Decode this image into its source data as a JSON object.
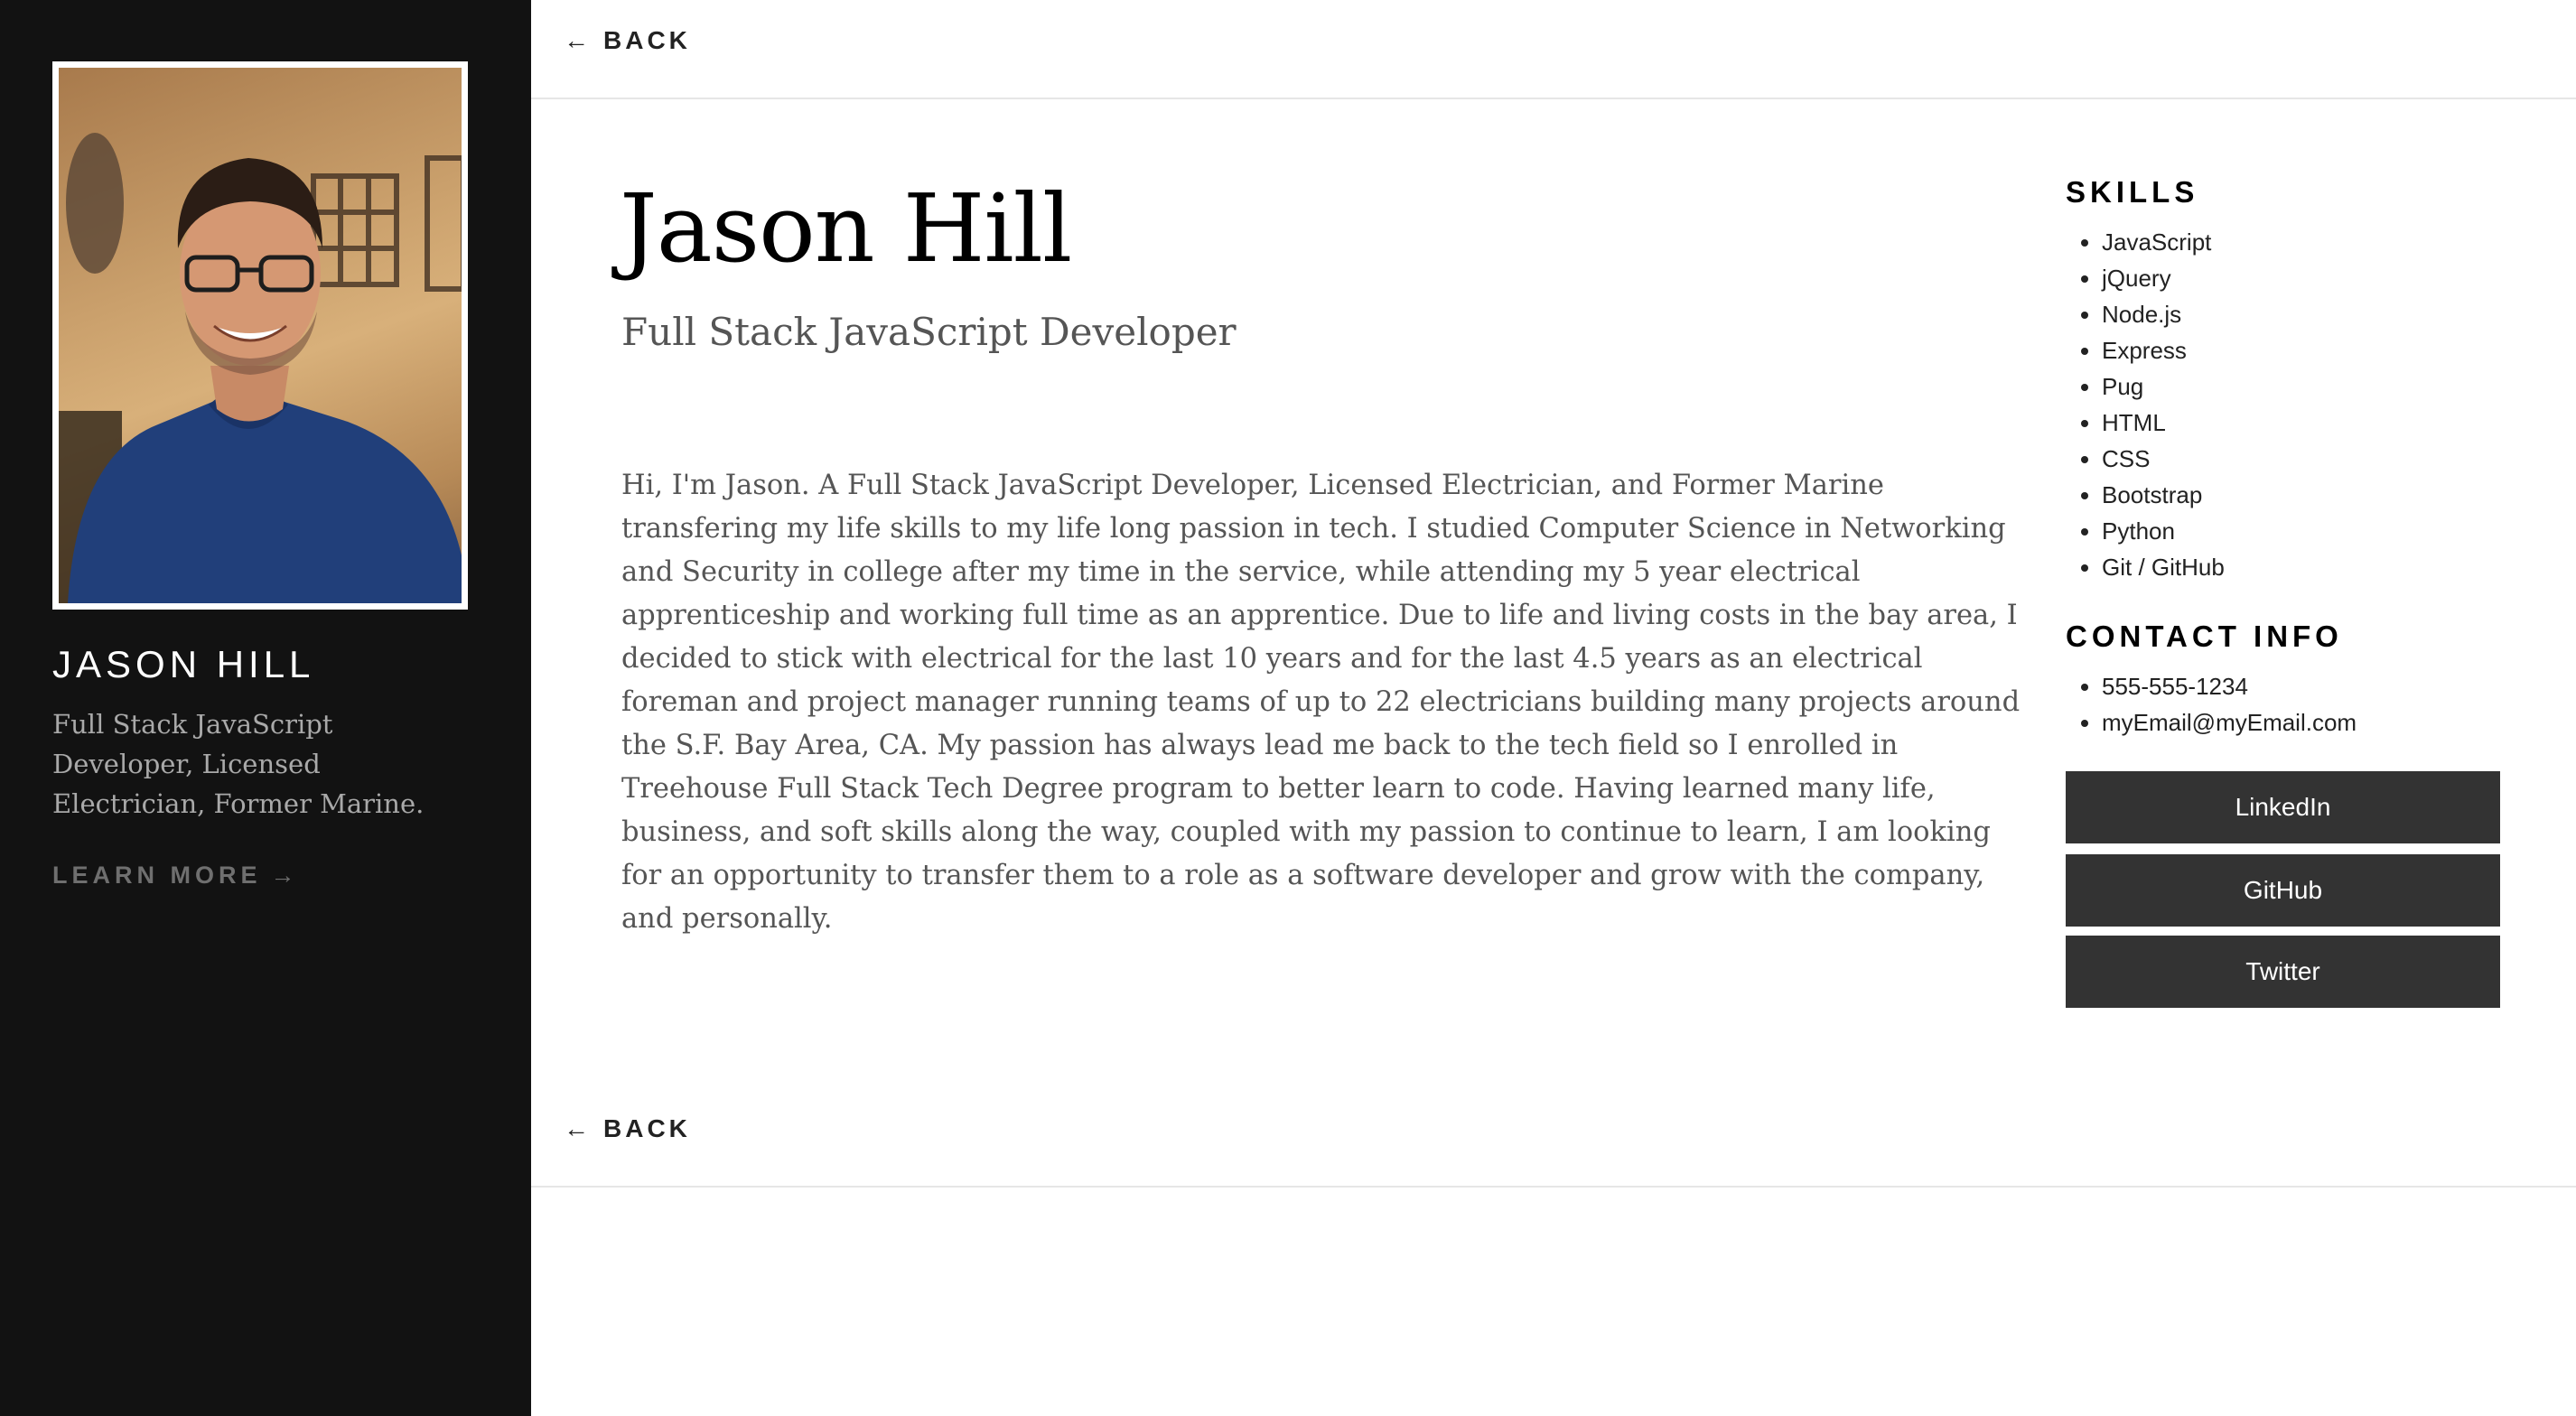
{
  "sidebar": {
    "name": "JASON HILL",
    "description": "Full Stack JavaScript Developer, Licensed Electrician, Former Marine.",
    "learn_more": "LEARN MORE",
    "learn_more_arrow": "→"
  },
  "nav": {
    "back_arrow": "←",
    "back_label": "BACK"
  },
  "main": {
    "title": "Jason Hill",
    "subtitle": "Full Stack JavaScript Developer",
    "bio": "Hi, I'm Jason. A Full Stack JavaScript Developer, Licensed Electrician, and Former Marine transfering my life skills to my life long passion in tech. I studied Computer Science in Networking and Security in college after my time in the service, while attending my 5 year electrical apprenticeship and working full time as an apprentice. Due to life and living costs in the bay area, I decided to stick with electrical for the last 10 years and for the last 4.5 years as an electrical foreman and project manager running teams of up to 22 electricians building many projects around the S.F. Bay Area, CA. My passion has always lead me back to the tech field so I enrolled in Treehouse Full Stack Tech Degree program to better learn to code. Having learned many life, business, and soft skills along the way, coupled with my passion to continue to learn, I am looking for an opportunity to transfer them to a role as a software developer and grow with the company, and personally."
  },
  "skills": {
    "heading": "SKILLS",
    "items": [
      "JavaScript",
      "jQuery",
      "Node.js",
      "Express",
      "Pug",
      "HTML",
      "CSS",
      "Bootstrap",
      "Python",
      "Git / GitHub"
    ]
  },
  "contact": {
    "heading": "CONTACT INFO",
    "phone": "555-555-1234",
    "email": "myEmail@myEmail.com"
  },
  "social": {
    "linkedin": "LinkedIn",
    "github": "GitHub",
    "twitter": "Twitter"
  },
  "colors": {
    "sidebar_bg": "#121212",
    "button_bg": "#333333",
    "text_muted": "#555555"
  }
}
